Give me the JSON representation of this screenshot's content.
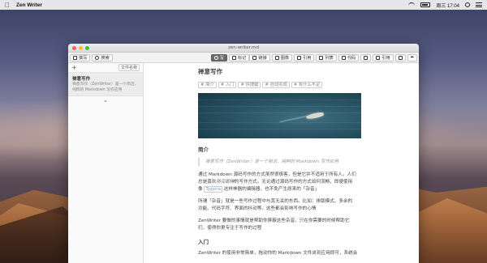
{
  "menubar": {
    "app_name": "Zen Writer",
    "clock": "周三 17:04",
    "icons": [
      "apple-icon",
      "wifi-icon",
      "battery-icon",
      "search-icon",
      "list-icon"
    ]
  },
  "window": {
    "title": "zen-writer.md"
  },
  "toolbar": {
    "compose": "撰写",
    "search": "搜索",
    "preview": "写",
    "tags": "标记",
    "link": "链接",
    "image": "图像",
    "quote": "引用",
    "list": "列表",
    "code": "代码",
    "cite": "引用"
  },
  "sidebar": {
    "add": "+",
    "sort": "文件名称",
    "doc_title": "禅意写作",
    "doc_excerpt": "禅意写作（ZenWriter）是一个简洁、纯粹的 Markdown 写作应用",
    "collapse": "⌃"
  },
  "editor": {
    "heading": "禅意写作",
    "tags": [
      "# 简介",
      "# 入门",
      "# 快捷键",
      "# 自动完成",
      "# 有什么不足"
    ],
    "section1": "简介",
    "quote": "禅意写作（ZenWriter）是一个简洁、纯粹的 Markdown 写作应用",
    "para1_a": "通过 Markdown 源码写作的方式虽然很极客，但是它并不适用于所有人。人们",
    "para1_b": "总是喜欢",
    "para1_em": "所见即得",
    "para1_c": "的写作方式。无论通过源码写作的方式如何流畅，即便使用",
    "para1_d": "像",
    "para1_code": "Typora",
    "para1_e": "这样神器的编辑器，也不免产生原来的「杂音」",
    "para2_a": "所谓「杂音」就是一些写作过程中与其无关的东西。比如：排版模式、多余的",
    "para2_b": "功能、代码字符、界面的抖动等。这些都会影响写作的心情",
    "para3_a": "ZenWriter 要做的事情就是帮助你屏蔽这些杂音，只在你需要的时候帮助它",
    "para3_b": "们，使得你更专注于写作的过程",
    "section2": "入门",
    "para4": "ZenWriter 的使用非常简单，拖动你的 Markdown 文件夹到应用即可，系统会"
  }
}
